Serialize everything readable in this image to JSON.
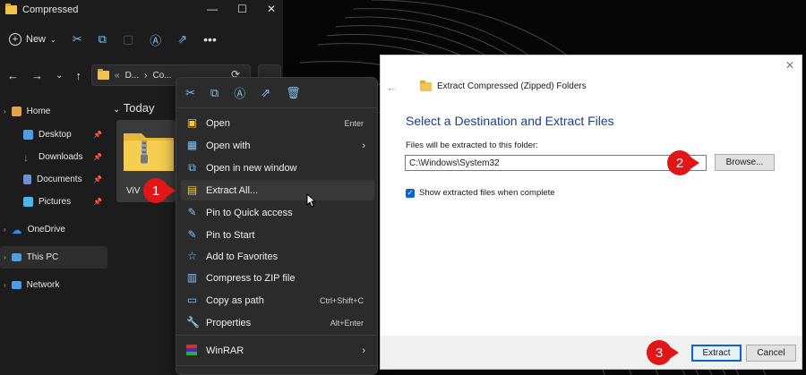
{
  "explorer": {
    "title": "Compressed",
    "new_label": "New",
    "address": [
      "D...",
      "Co..."
    ],
    "group_today": "Today",
    "file_label": "ViV",
    "sidebar": [
      {
        "label": "Home",
        "icon": "home-icon",
        "color": "#e8a13c"
      },
      {
        "label": "Desktop",
        "icon": "desktop-icon",
        "color": "#4aa0e6"
      },
      {
        "label": "Downloads",
        "icon": "download-icon",
        "color": "#3fb3a0"
      },
      {
        "label": "Documents",
        "icon": "document-icon",
        "color": "#6c8fd6"
      },
      {
        "label": "Pictures",
        "icon": "pictures-icon",
        "color": "#4db6e8"
      },
      {
        "label": "OneDrive",
        "icon": "cloud-icon",
        "color": "#2d8ceb"
      },
      {
        "label": "This PC",
        "icon": "computer-icon",
        "color": "#4aa0e6"
      },
      {
        "label": "Network",
        "icon": "network-icon",
        "color": "#4aa0e6"
      }
    ]
  },
  "context_menu": {
    "items": [
      {
        "label": "Open",
        "shortcut": "Enter",
        "icon": "open-icon"
      },
      {
        "label": "Open with",
        "shortcut": "",
        "icon": "open-with-icon",
        "submenu": true
      },
      {
        "label": "Open in new window",
        "shortcut": "",
        "icon": "new-window-icon"
      },
      {
        "label": "Extract All...",
        "shortcut": "",
        "icon": "extract-icon"
      },
      {
        "label": "Pin to Quick access",
        "shortcut": "",
        "icon": "pin-icon"
      },
      {
        "label": "Pin to Start",
        "shortcut": "",
        "icon": "pin-start-icon"
      },
      {
        "label": "Add to Favorites",
        "shortcut": "",
        "icon": "star-icon"
      },
      {
        "label": "Compress to ZIP file",
        "shortcut": "",
        "icon": "zip-icon"
      },
      {
        "label": "Copy as path",
        "shortcut": "Ctrl+Shift+C",
        "icon": "copy-path-icon"
      },
      {
        "label": "Properties",
        "shortcut": "Alt+Enter",
        "icon": "properties-icon"
      },
      {
        "label": "WinRAR",
        "shortcut": "",
        "icon": "winrar-icon",
        "submenu": true
      }
    ]
  },
  "dialog": {
    "title": "Extract Compressed (Zipped) Folders",
    "heading": "Select a Destination and Extract Files",
    "dest_label": "Files will be extracted to this folder:",
    "dest_value": "C:\\Windows\\System32",
    "browse_label": "Browse...",
    "show_files_label": "Show extracted files when complete",
    "extract_label": "Extract",
    "cancel_label": "Cancel"
  },
  "steps": [
    "1",
    "2",
    "3"
  ],
  "colors": {
    "accent": "#0a64d8",
    "step_red": "#e11717",
    "menu_bg": "#2b2b2b"
  }
}
